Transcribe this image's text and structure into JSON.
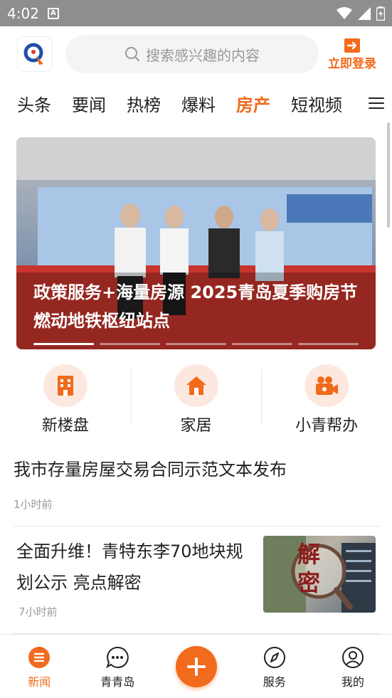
{
  "status_bar": {
    "time": "4:02",
    "notification_letter": "A"
  },
  "header": {
    "search_placeholder": "搜索感兴趣的内容",
    "login_label": "立即登录"
  },
  "tabs": [
    {
      "label": "头条"
    },
    {
      "label": "要闻"
    },
    {
      "label": "热榜"
    },
    {
      "label": "爆料"
    },
    {
      "label": "房产",
      "active": true
    },
    {
      "label": "短视频"
    }
  ],
  "banner": {
    "title": "政策服务+海量房源 2025青岛夏季购房节燃动地铁枢纽站点",
    "slide_count": 5,
    "active_slide": 1
  },
  "quick_links": [
    {
      "label": "新楼盘",
      "icon": "building-icon"
    },
    {
      "label": "家居",
      "icon": "house-icon"
    },
    {
      "label": "小青帮办",
      "icon": "video-camera-icon"
    }
  ],
  "news": [
    {
      "title": "我市存量房屋交易合同示范文本发布",
      "time": "1小时前"
    },
    {
      "title": "全面升维！青特东李70地块规划公示 亮点解密",
      "time": "7小时前",
      "thumb_text": "解密"
    }
  ],
  "bottom_nav": [
    {
      "label": "新闻",
      "icon": "news-icon",
      "active": true
    },
    {
      "label": "青青岛",
      "icon": "chat-icon"
    },
    {
      "label": "",
      "icon": "plus-icon"
    },
    {
      "label": "服务",
      "icon": "compass-icon"
    },
    {
      "label": "我的",
      "icon": "profile-icon"
    }
  ],
  "colors": {
    "accent": "#f26a1b",
    "status_bar": "#8e8e8e"
  }
}
